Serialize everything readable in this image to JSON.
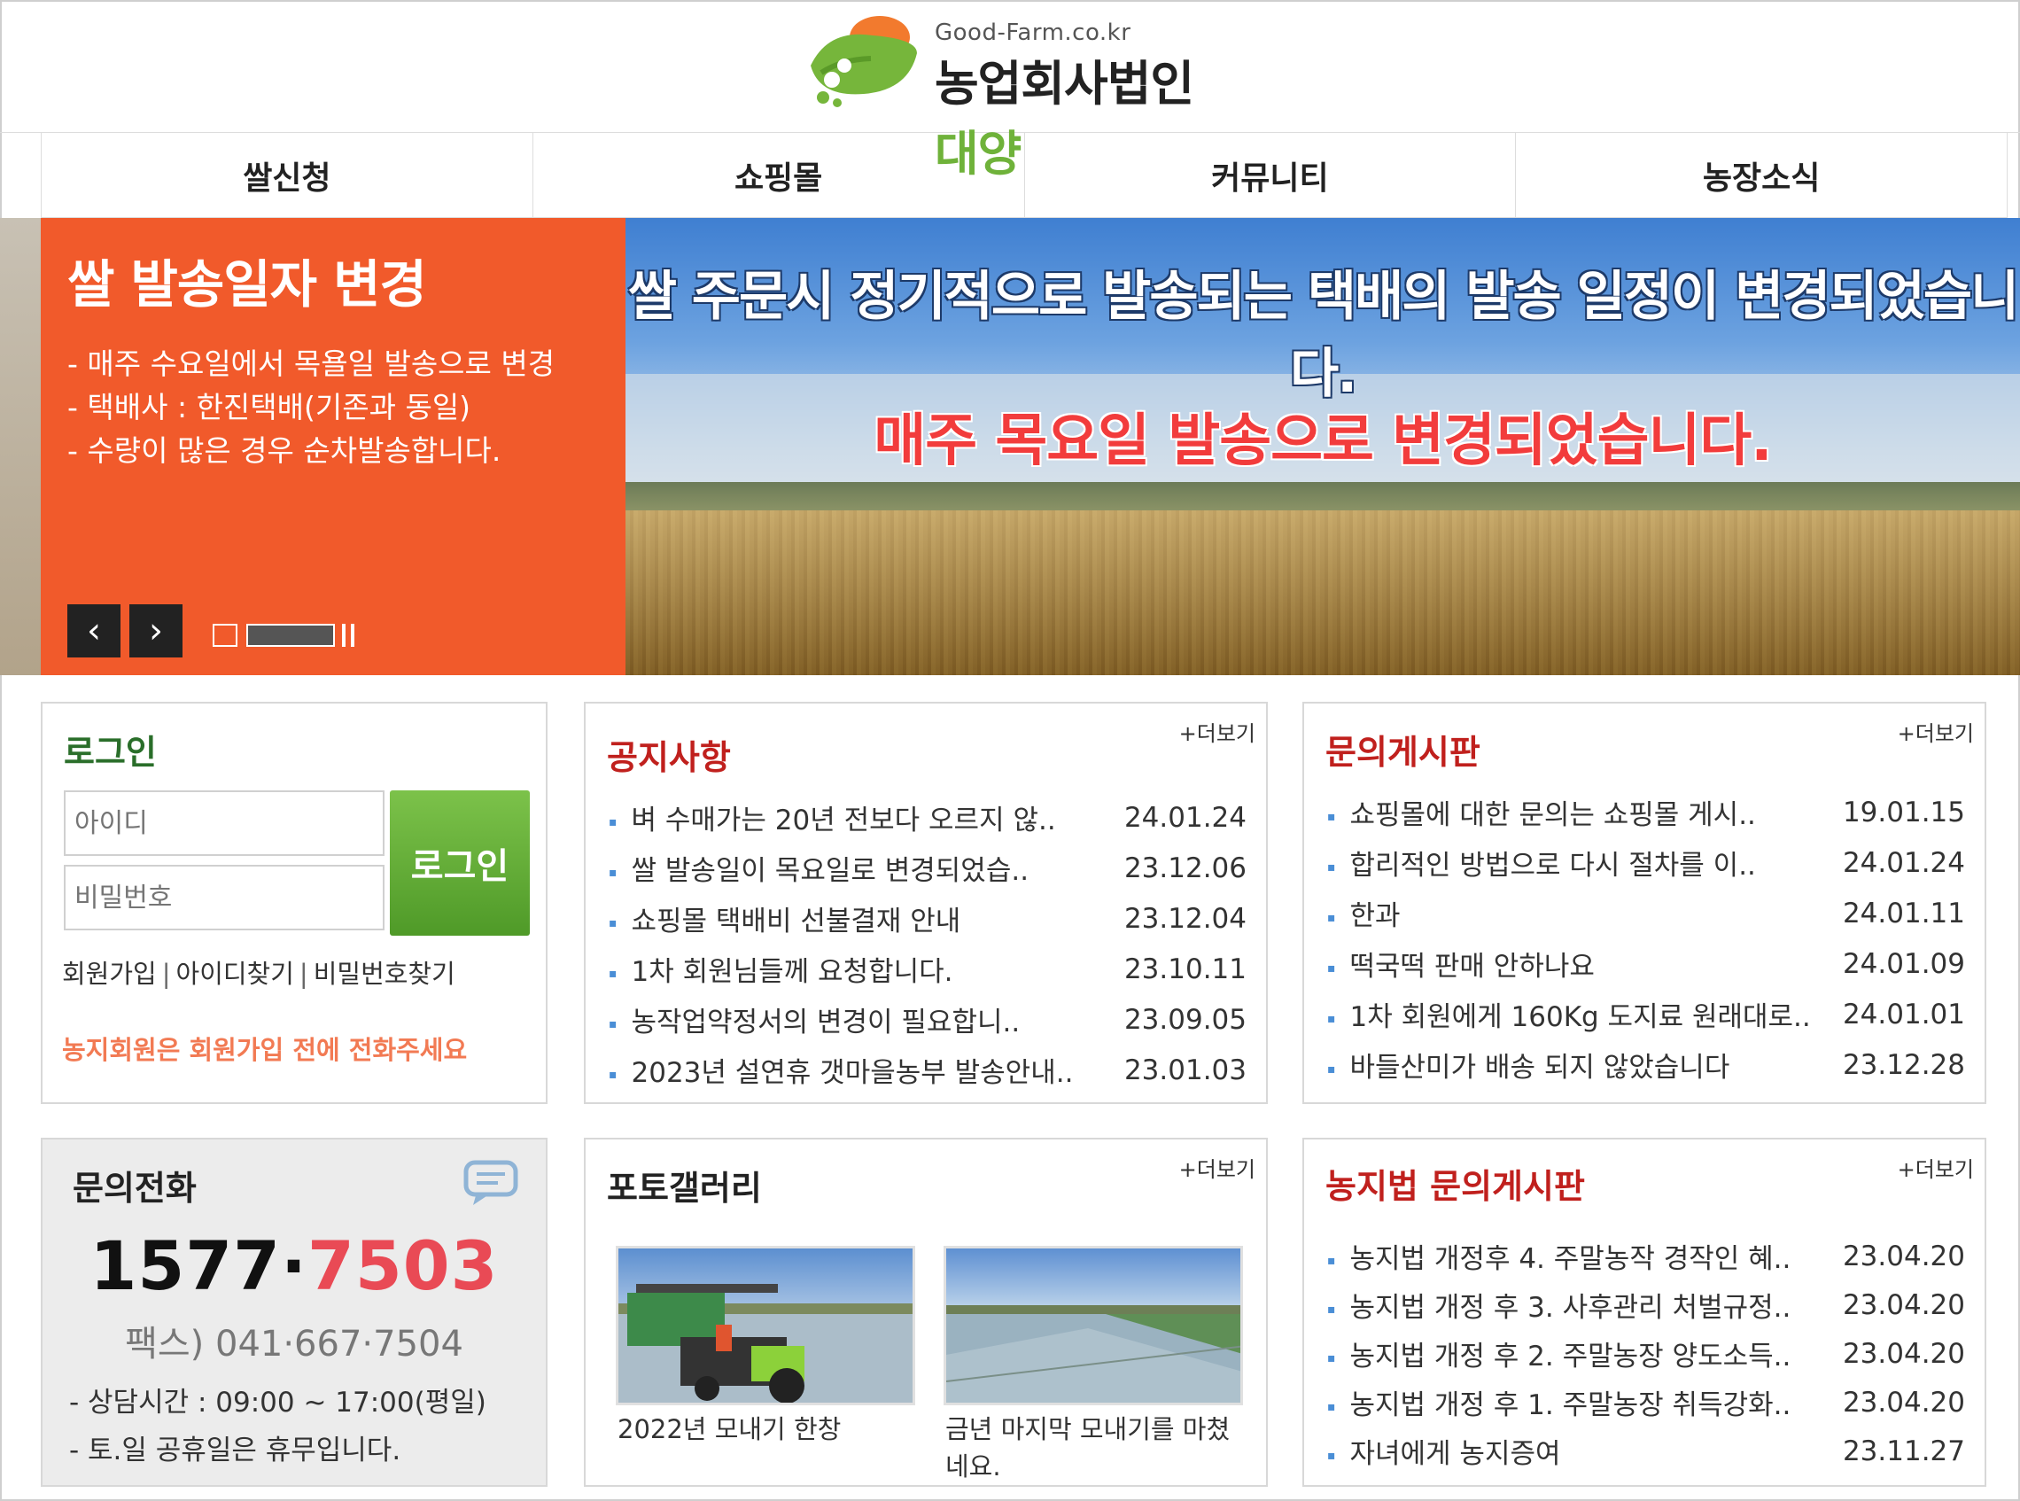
{
  "logo": {
    "domain": "Good-Farm.co.kr",
    "company_main": "농업회사법인 ",
    "company_accent": "대양"
  },
  "nav": {
    "items": [
      {
        "label": "쌀신청"
      },
      {
        "label": "쇼핑몰"
      },
      {
        "label": "커뮤니티"
      },
      {
        "label": "농장소식"
      }
    ]
  },
  "banner": {
    "title": "쌀 발송일자 변경",
    "lines": [
      "- 매주 수요일에서 목욜일 발송으로 변경",
      "- 택배사 : 한진택배(기존과 동일)",
      "- 수량이 많은 경우 순차발송합니다."
    ],
    "headline": "쌀 주문시 정기적으로 발송되는 택배의 발송 일정이 변경되었습니다.",
    "subline": "매주 목요일 발송으로 변경되었습니다.",
    "prev_icon": "‹",
    "next_icon": "›"
  },
  "login": {
    "title": "로그인",
    "id_placeholder": "아이디",
    "pw_placeholder": "비밀번호",
    "button": "로그인",
    "signup": "회원가입",
    "find_id": "아이디찾기",
    "find_pw": "비밀번호찾기",
    "separator": "|",
    "notice": "농지회원은 회원가입 전에 전화주세요"
  },
  "notice_board": {
    "title": "공지사항",
    "more": "+더보기",
    "items": [
      {
        "text": "벼 수매가는 20년 전보다 오르지 않..",
        "date": "24.01.24"
      },
      {
        "text": "쌀 발송일이 목요일로 변경되었습..",
        "date": "23.12.06"
      },
      {
        "text": "쇼핑몰 택배비 선불결재 안내",
        "date": "23.12.04"
      },
      {
        "text": "1차 회원님들께 요청합니다.",
        "date": "23.10.11"
      },
      {
        "text": "농작업약정서의 변경이 필요합니..",
        "date": "23.09.05"
      },
      {
        "text": "2023년 설연휴 갯마을농부 발송안내..",
        "date": "23.01.03"
      }
    ]
  },
  "qna_board": {
    "title": "문의게시판",
    "more": "+더보기",
    "items": [
      {
        "text": "쇼핑몰에 대한 문의는 쇼핑몰 게시..",
        "date": "19.01.15"
      },
      {
        "text": "합리적인 방법으로 다시 절차를 이..",
        "date": "24.01.24"
      },
      {
        "text": "한과",
        "date": "24.01.11"
      },
      {
        "text": "떡국떡 판매 안하나요",
        "date": "24.01.09"
      },
      {
        "text": "1차 회원에게 160Kg 도지료 원래대로..",
        "date": "24.01.01"
      },
      {
        "text": "바들산미가 배송 되지 않았습니다",
        "date": "23.12.28"
      }
    ]
  },
  "phone": {
    "title": "문의전화",
    "number_prefix": "1577·",
    "number_suffix": "7503",
    "fax": "팩스) 041·667·7504",
    "hours": "- 상담시간 : 09:00 ~ 17:00(평일)",
    "holiday": "- 토.일 공휴일은 휴무입니다."
  },
  "gallery": {
    "title": "포토갤러리",
    "more": "+더보기",
    "items": [
      {
        "caption": "2022년 모내기 한창"
      },
      {
        "caption": "금년 마지막 모내기를 마쳤네요."
      }
    ]
  },
  "farm_board": {
    "title": "농지법 문의게시판",
    "more": "+더보기",
    "items": [
      {
        "text": "농지법 개정후 4. 주말농작 경작인 혜..",
        "date": "23.04.20"
      },
      {
        "text": "농지법 개정 후 3. 사후관리 처벌규정..",
        "date": "23.04.20"
      },
      {
        "text": "농지법 개정 후 2. 주말농장 양도소득..",
        "date": "23.04.20"
      },
      {
        "text": "농지법 개정 후 1. 주말농장 취득강화..",
        "date": "23.04.20"
      },
      {
        "text": "자녀에게 농지증여",
        "date": "23.11.27"
      }
    ]
  },
  "colors": {
    "banner_orange": "#f15a2b",
    "login_green": "#5fa832",
    "title_red": "#c0201d",
    "phone_highlight": "#e94a55"
  },
  "icons": [
    "logo-mark-icon",
    "chevron-left-icon",
    "chevron-right-icon",
    "pause-icon",
    "chat-bubble-icon",
    "bullet-icon"
  ]
}
